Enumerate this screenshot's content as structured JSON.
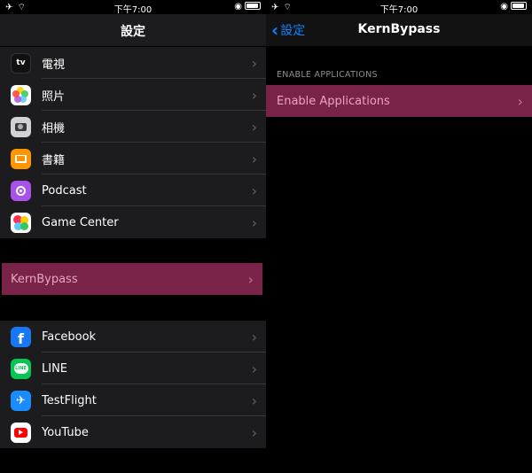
{
  "status_bar": {
    "time": "下午7:00"
  },
  "left_screen": {
    "title": "設定",
    "group1": [
      {
        "label": "電視",
        "icon": "apple-tv-icon"
      },
      {
        "label": "照片",
        "icon": "photos-icon"
      },
      {
        "label": "相機",
        "icon": "camera-icon"
      },
      {
        "label": "書籍",
        "icon": "books-icon"
      },
      {
        "label": "Podcast",
        "icon": "podcast-icon"
      },
      {
        "label": "Game Center",
        "icon": "game-center-icon"
      }
    ],
    "highlight_item": {
      "label": "KernBypass"
    },
    "group3": [
      {
        "label": "Facebook",
        "icon": "facebook-icon"
      },
      {
        "label": "LINE",
        "icon": "line-icon"
      },
      {
        "label": "TestFlight",
        "icon": "testflight-icon"
      },
      {
        "label": "YouTube",
        "icon": "youtube-icon"
      }
    ],
    "icon_glyphs": {
      "tv": "tv",
      "facebook": "f",
      "line": "LINE",
      "testflight": "✈"
    }
  },
  "right_screen": {
    "back_label": "設定",
    "title": "KernBypass",
    "section_header": "ENABLE APPLICATIONS",
    "highlight_item": {
      "label": "Enable Applications"
    }
  },
  "colors": {
    "highlight": "#7a2348",
    "ios_blue": "#0a84ff",
    "cell_bg": "#1c1c1e"
  }
}
